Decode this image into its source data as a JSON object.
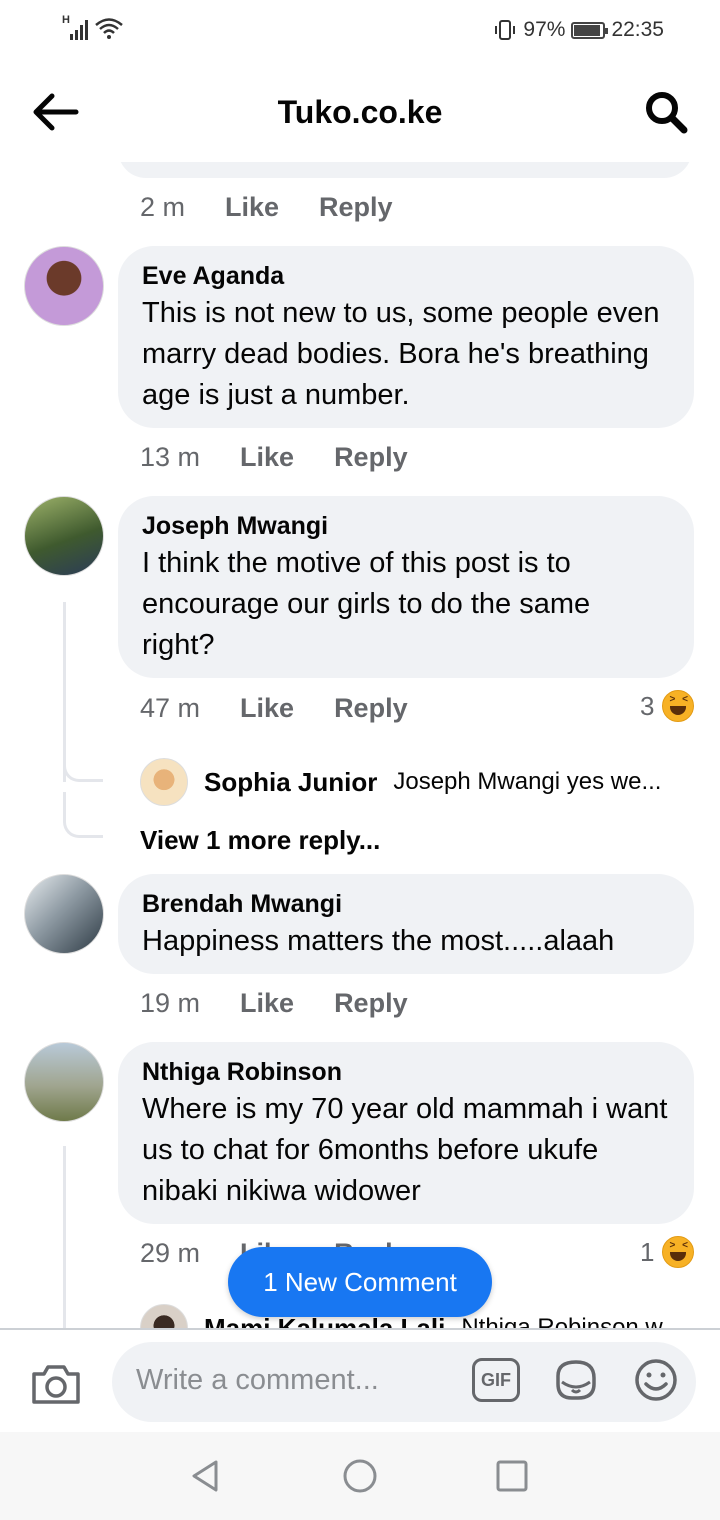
{
  "status_bar": {
    "network": "H",
    "battery": "97%",
    "time": "22:35"
  },
  "header": {
    "title": "Tuko.co.ke"
  },
  "top_meta": {
    "time": "2 m",
    "like": "Like",
    "reply": "Reply"
  },
  "comments": [
    {
      "name": "Eve Aganda",
      "text": "This is not new to us, some people even marry dead bodies. Bora he's breathing age is just a number.",
      "time": "13 m",
      "like": "Like",
      "reply": "Reply"
    },
    {
      "name": "Joseph Mwangi",
      "text": "I think the motive of this post is to encourage our girls to do the same right?",
      "time": "47 m",
      "like": "Like",
      "reply": "Reply",
      "reactions": "3",
      "replies": [
        {
          "name": "Sophia Junior",
          "text": "Joseph Mwangi yes we..."
        }
      ],
      "view_more": "View 1 more reply..."
    },
    {
      "name": "Brendah Mwangi",
      "text": "Happiness matters the most.....alaah",
      "time": "19 m",
      "like": "Like",
      "reply": "Reply"
    },
    {
      "name": "Nthiga Robinson",
      "text": "Where is my 70 year old mammah i want us to chat for 6months before ukufe nibaki nikiwa widower",
      "time": "29 m",
      "like": "Like",
      "reply": "Reply",
      "reactions": "1",
      "replies": [
        {
          "name": "Mami Kalumala Lali",
          "text": "Nthiga Robinson w..."
        }
      ]
    }
  ],
  "new_comment_button": "1 New Comment",
  "composer": {
    "placeholder": "Write a comment...",
    "gif": "GIF"
  },
  "icons": {
    "back": "back-arrow-icon",
    "search": "search-icon",
    "camera": "camera-icon",
    "sticker": "sticker-icon",
    "emoji": "smiley-icon",
    "haha": "haha-reaction-icon"
  },
  "colors": {
    "accent": "#1877f2",
    "bubble": "#f0f2f5",
    "meta": "#65676b"
  }
}
